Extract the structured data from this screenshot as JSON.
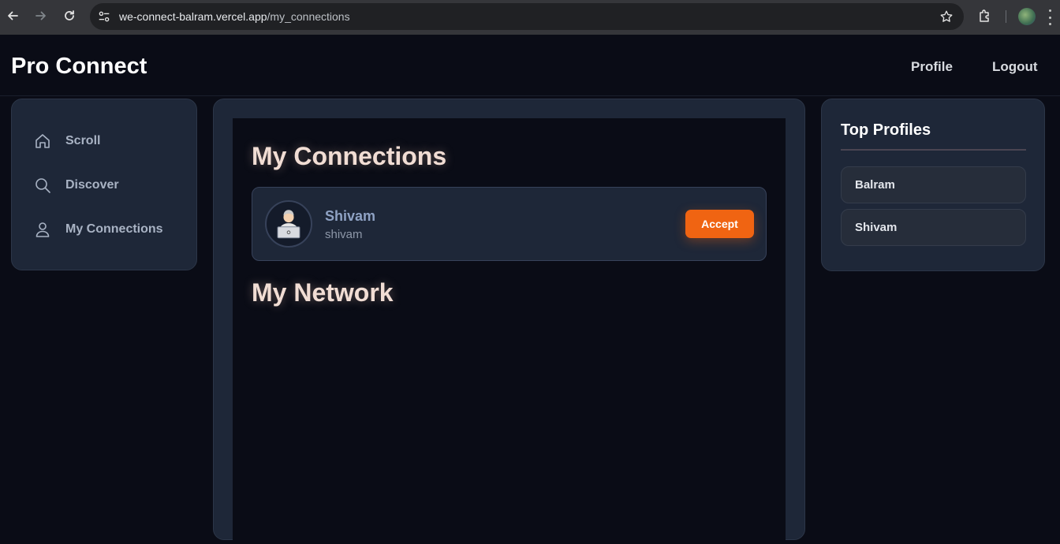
{
  "browser": {
    "url_host": "we-connect-balram.vercel.app",
    "url_path": "/my_connections",
    "icons": [
      "back-icon",
      "forward-icon",
      "reload-icon",
      "site-info-icon",
      "bookmark-star-icon",
      "extensions-icon",
      "profile-avatar",
      "menu-icon"
    ]
  },
  "header": {
    "brand": "Pro Connect",
    "nav": [
      {
        "label": "Profile"
      },
      {
        "label": "Logout"
      }
    ]
  },
  "sidebar": {
    "items": [
      {
        "label": "Scroll",
        "icon": "home-icon"
      },
      {
        "label": "Discover",
        "icon": "search-icon"
      },
      {
        "label": "My Connections",
        "icon": "user-icon"
      }
    ]
  },
  "main": {
    "connections_title": "My Connections",
    "requests": [
      {
        "name": "Shivam",
        "username": "shivam",
        "action_label": "Accept"
      }
    ],
    "network_title": "My Network"
  },
  "top_profiles": {
    "title": "Top Profiles",
    "items": [
      {
        "name": "Balram"
      },
      {
        "name": "Shivam"
      }
    ]
  },
  "colors": {
    "accent": "#f06412",
    "panel": "#1e2738",
    "background": "#0a0c16"
  }
}
